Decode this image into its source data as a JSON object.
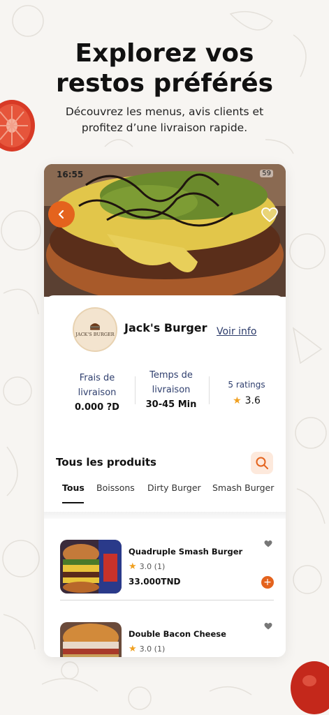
{
  "headline": {
    "line1": "Explorez vos",
    "line2": "restos préférés"
  },
  "subline": {
    "line1": "Découvrez les menus, avis clients et",
    "line2": "profitez d’une livraison rapide."
  },
  "phone": {
    "status": {
      "time": "16:55",
      "battery": "59"
    },
    "restaurant": {
      "name": "Jack's Burger",
      "logo_text": "JACK'S BURGER",
      "info_link": "Voir info"
    },
    "stats": {
      "delivery_fee": {
        "label_line1": "Frais de",
        "label_line2": "livraison",
        "value": "0.000 ?D"
      },
      "delivery_time": {
        "label_line1": "Temps de",
        "label_line2": "livraison",
        "value": "30-45 Min"
      },
      "ratings": {
        "label": "5 ratings",
        "value": "3.6"
      }
    },
    "products_title": "Tous les produits",
    "tabs": [
      "Tous",
      "Boissons",
      "Dirty Burger",
      "Smash Burger"
    ],
    "active_tab": "Tous",
    "products": [
      {
        "name": "Quadruple Smash Burger",
        "rating": "3.0",
        "count": "(1)",
        "price": "33.000TND"
      },
      {
        "name": "Double Bacon Cheese",
        "rating": "3.0",
        "count": "(1)",
        "price": ""
      }
    ]
  },
  "colors": {
    "accent": "#e4631d",
    "star": "#f0a020",
    "link": "#2d3c6b",
    "background": "#f7f5f2"
  },
  "icons": [
    "back-arrow-icon",
    "heart-icon",
    "search-icon",
    "star-icon",
    "plus-icon"
  ]
}
